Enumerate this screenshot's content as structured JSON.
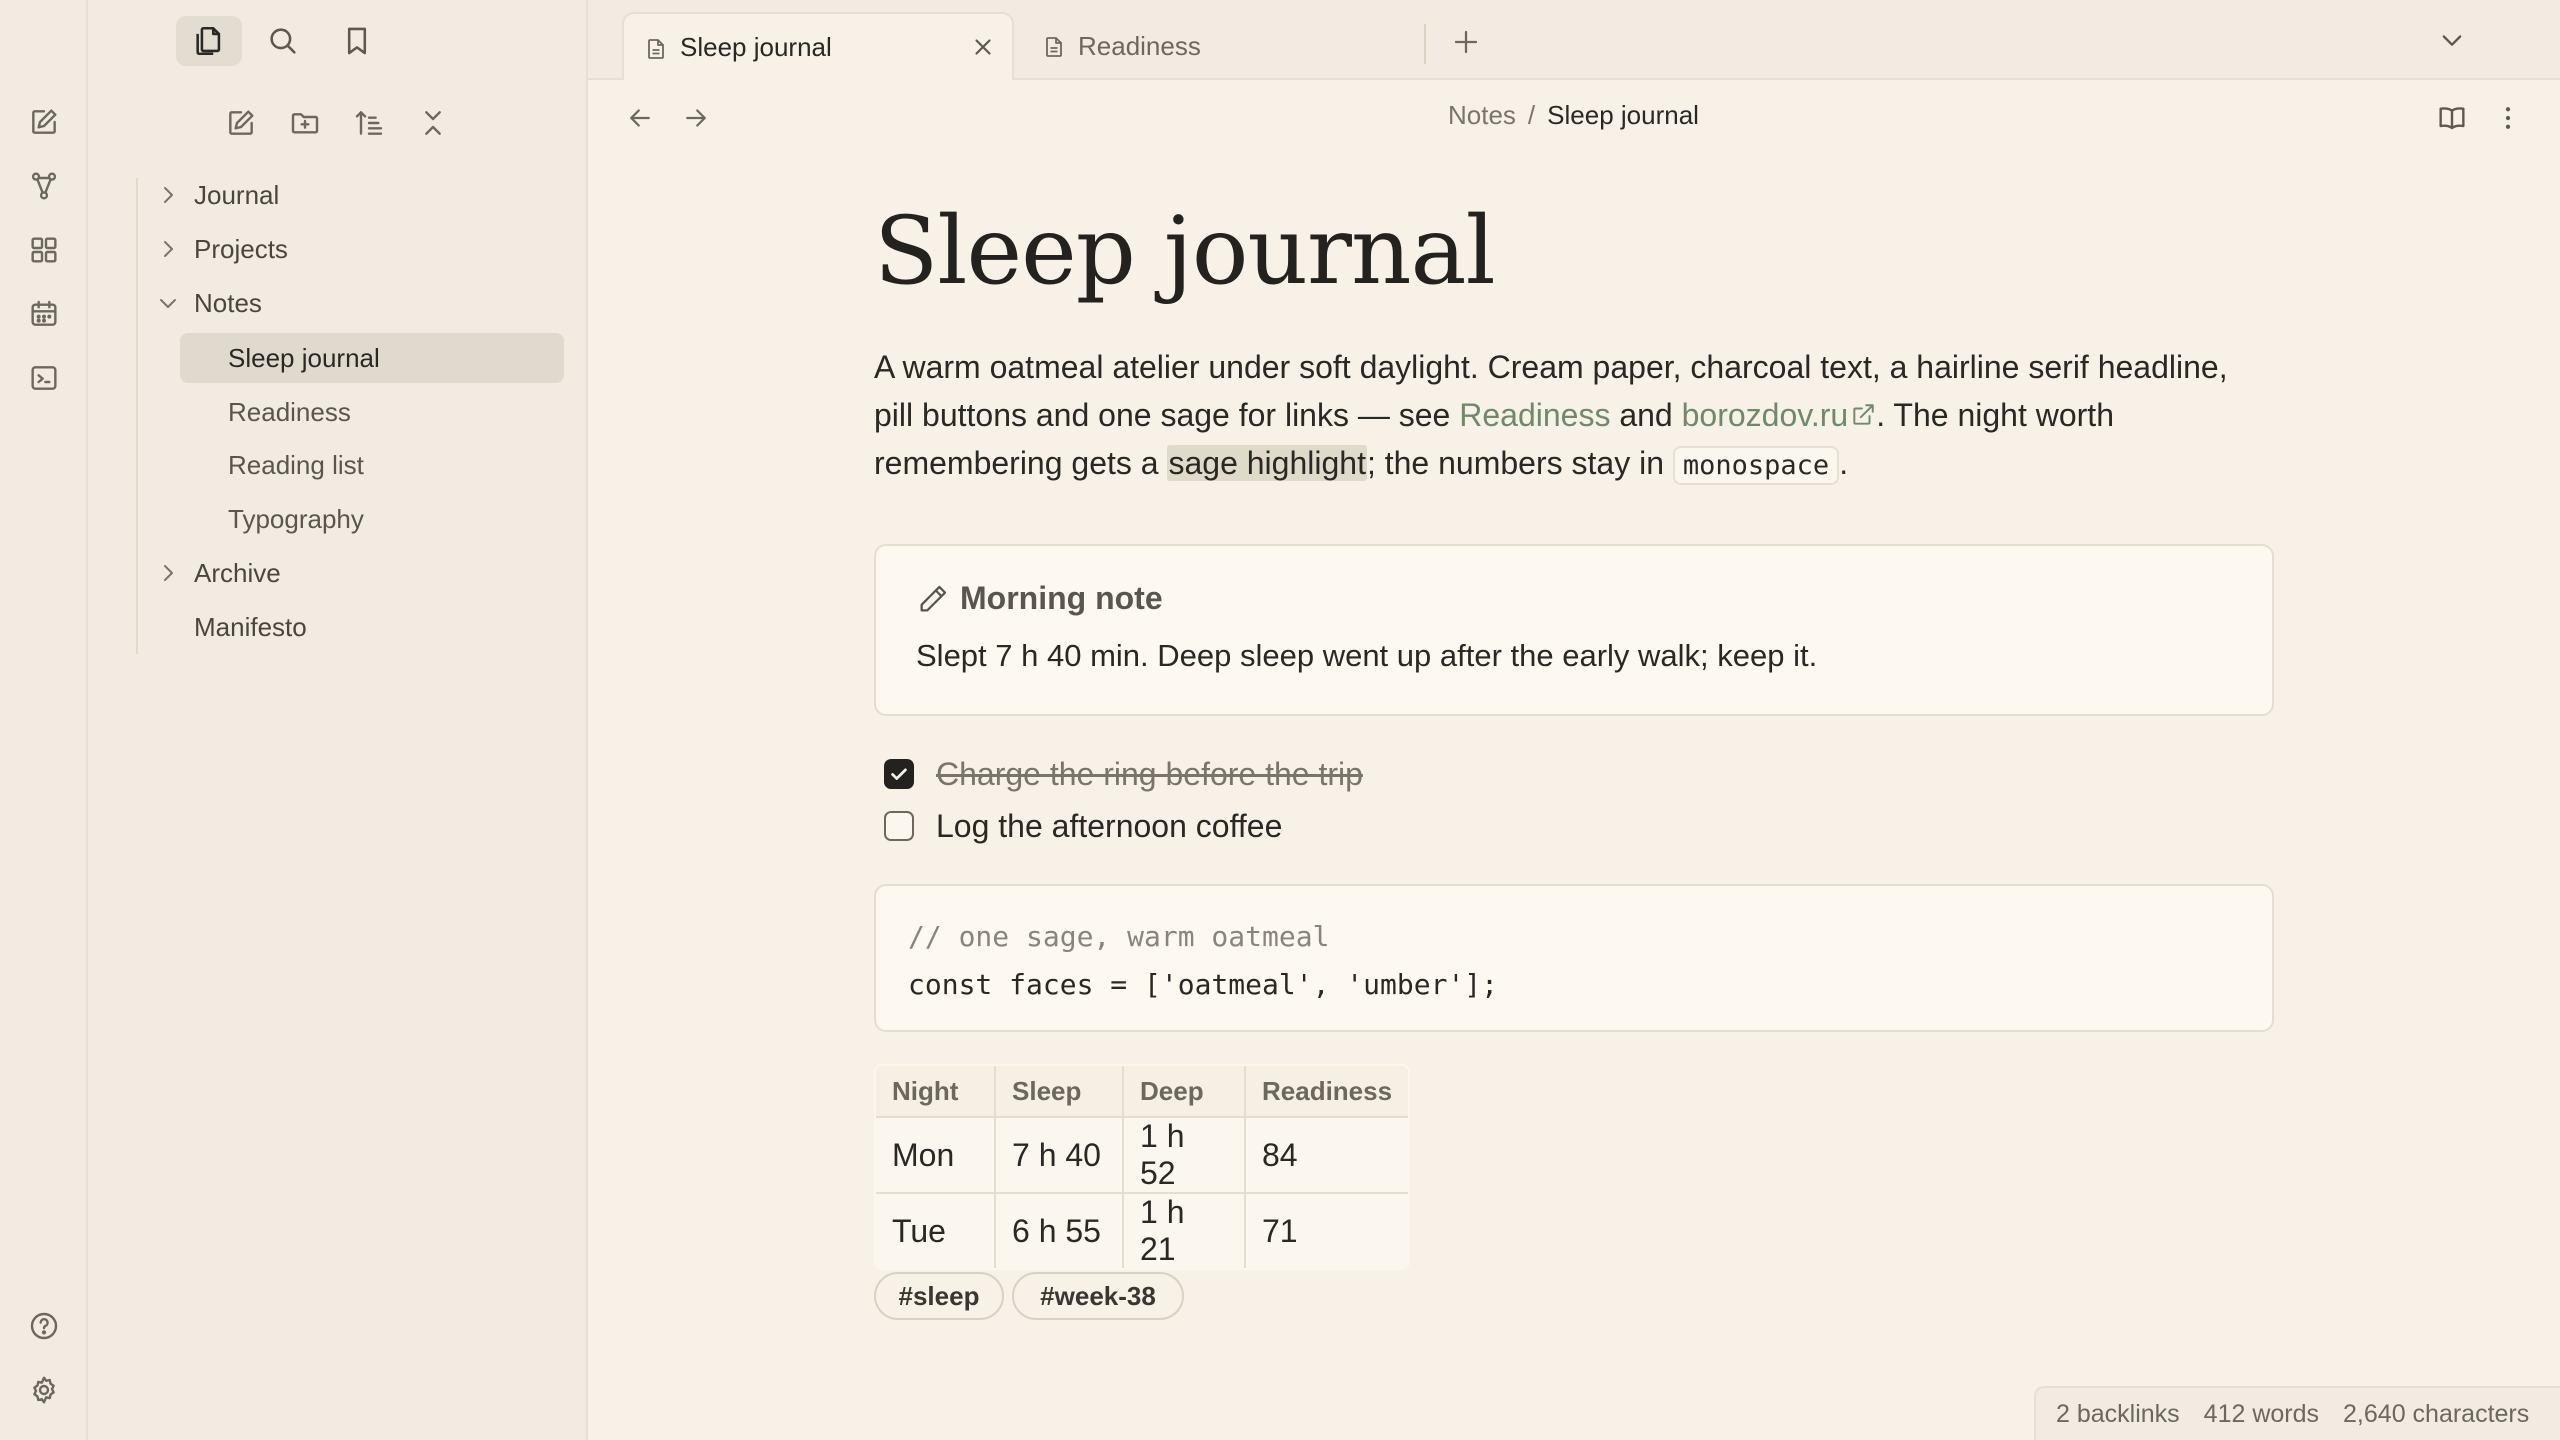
{
  "sidebar": {
    "tree": [
      {
        "label": "Journal",
        "type": "folder",
        "expanded": false
      },
      {
        "label": "Projects",
        "type": "folder",
        "expanded": false
      },
      {
        "label": "Notes",
        "type": "folder",
        "expanded": true
      },
      {
        "label": "Sleep journal",
        "type": "file",
        "selected": true
      },
      {
        "label": "Readiness",
        "type": "file"
      },
      {
        "label": "Reading list",
        "type": "file"
      },
      {
        "label": "Typography",
        "type": "file"
      },
      {
        "label": "Archive",
        "type": "folder",
        "expanded": false
      },
      {
        "label": "Manifesto",
        "type": "file"
      }
    ]
  },
  "tabs": [
    {
      "label": "Sleep journal",
      "active": true
    },
    {
      "label": "Readiness",
      "active": false
    }
  ],
  "breadcrumb": {
    "parent": "Notes",
    "separator": "/",
    "current": "Sleep journal"
  },
  "note": {
    "title": "Sleep journal",
    "intro": {
      "p1": "A warm oatmeal atelier under soft daylight. Cream paper, charcoal text, a hairline serif headline, pill buttons and one sage for links — see ",
      "link1": "Readiness",
      "p2": " and ",
      "link2": "borozdov.ru",
      "p3": ". The night worth remembering gets a ",
      "highlight": "sage highlight",
      "p4": "; the numbers stay in ",
      "code": "monospace",
      "p5": "."
    },
    "callout": {
      "title": "Morning note",
      "body": "Slept 7 h 40 min. Deep sleep went up after the early walk; keep it."
    },
    "tasks": [
      {
        "label": "Charge the ring before the trip",
        "done": true
      },
      {
        "label": "Log the afternoon coffee",
        "done": false
      }
    ],
    "code": {
      "line1": "// one sage, warm oatmeal",
      "line2": "const faces = ['oatmeal', 'umber'];"
    },
    "table": {
      "headers": [
        "Night",
        "Sleep",
        "Deep",
        "Readiness"
      ],
      "rows": [
        [
          "Mon",
          "7 h 40",
          "1 h 52",
          "84"
        ],
        [
          "Tue",
          "6 h 55",
          "1 h 21",
          "71"
        ]
      ]
    },
    "tags": [
      "#sleep",
      "#week-38"
    ]
  },
  "status": {
    "backlinks": "2 backlinks",
    "words": "412 words",
    "characters": "2,640 characters"
  },
  "colors": {
    "background": "#f7f1e7",
    "sidebar": "#f1ebe1",
    "text": "#2a2825",
    "link_sage": "#6f8a6b",
    "highlight": "#dfdac9"
  }
}
